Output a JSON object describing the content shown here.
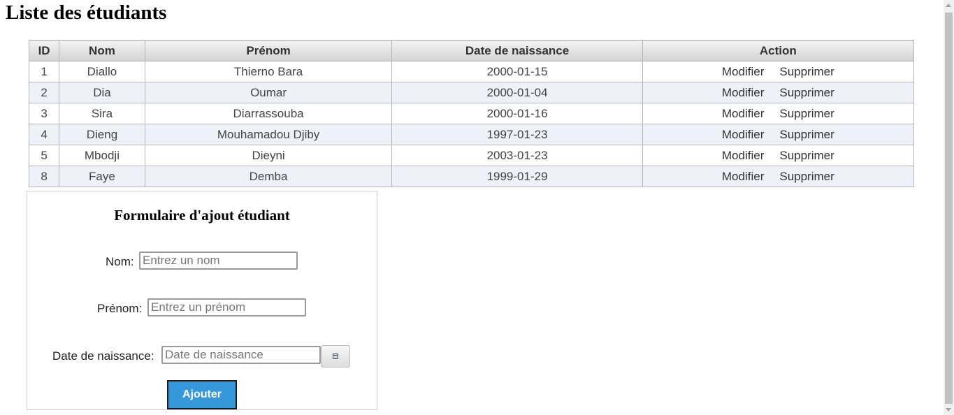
{
  "page": {
    "title": "Liste des étudiants"
  },
  "table": {
    "headers": [
      "ID",
      "Nom",
      "Prénom",
      "Date de naissance",
      "Action"
    ],
    "rows": [
      {
        "id": "1",
        "nom": "Diallo",
        "prenom": "Thierno Bara",
        "date": "2000-01-15",
        "modifier": "Modifier",
        "supprimer": "Supprimer"
      },
      {
        "id": "2",
        "nom": "Dia",
        "prenom": "Oumar",
        "date": "2000-01-04",
        "modifier": "Modifier",
        "supprimer": "Supprimer"
      },
      {
        "id": "3",
        "nom": "Sira",
        "prenom": "Diarrassouba",
        "date": "2000-01-16",
        "modifier": "Modifier",
        "supprimer": "Supprimer"
      },
      {
        "id": "4",
        "nom": "Dieng",
        "prenom": "Mouhamadou Djiby",
        "date": "1997-01-23",
        "modifier": "Modifier",
        "supprimer": "Supprimer"
      },
      {
        "id": "5",
        "nom": "Mbodji",
        "prenom": "Dieyni",
        "date": "2003-01-23",
        "modifier": "Modifier",
        "supprimer": "Supprimer"
      },
      {
        "id": "8",
        "nom": "Faye",
        "prenom": "Demba",
        "date": "1999-01-29",
        "modifier": "Modifier",
        "supprimer": "Supprimer"
      }
    ]
  },
  "form": {
    "title": "Formulaire d'ajout étudiant",
    "nom_label": "Nom:",
    "nom_placeholder": "Entrez un nom",
    "prenom_label": "Prénom:",
    "prenom_placeholder": "Entrez un prénom",
    "date_label": "Date de naissance:",
    "date_placeholder": "Date de naissance",
    "calendar_icon": "calendar-icon",
    "submit_label": "Ajouter"
  },
  "colors": {
    "submit_bg": "#3498db",
    "even_row_bg": "#eef2f8"
  }
}
